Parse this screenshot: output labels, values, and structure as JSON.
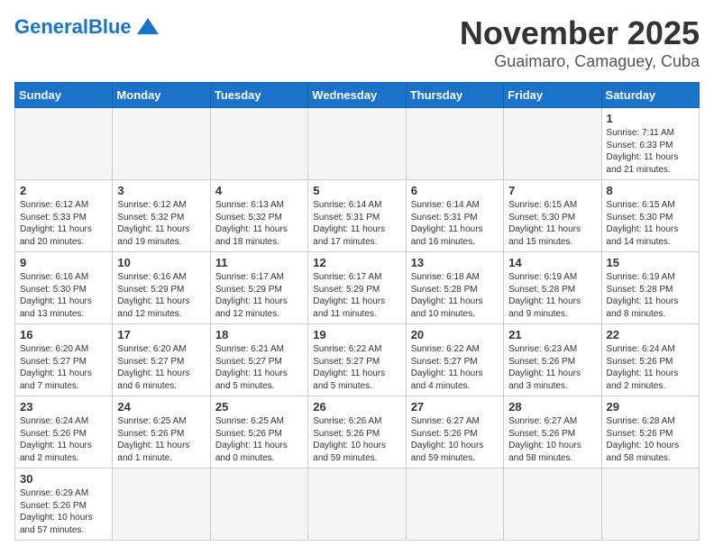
{
  "header": {
    "logo_general": "General",
    "logo_blue": "Blue",
    "month": "November 2025",
    "location": "Guaimaro, Camaguey, Cuba"
  },
  "days_of_week": [
    "Sunday",
    "Monday",
    "Tuesday",
    "Wednesday",
    "Thursday",
    "Friday",
    "Saturday"
  ],
  "weeks": [
    [
      {
        "day": null,
        "info": null
      },
      {
        "day": null,
        "info": null
      },
      {
        "day": null,
        "info": null
      },
      {
        "day": null,
        "info": null
      },
      {
        "day": null,
        "info": null
      },
      {
        "day": null,
        "info": null
      },
      {
        "day": "1",
        "info": "Sunrise: 7:11 AM\nSunset: 6:33 PM\nDaylight: 11 hours\nand 21 minutes."
      }
    ],
    [
      {
        "day": "2",
        "info": "Sunrise: 6:12 AM\nSunset: 5:33 PM\nDaylight: 11 hours\nand 20 minutes."
      },
      {
        "day": "3",
        "info": "Sunrise: 6:12 AM\nSunset: 5:32 PM\nDaylight: 11 hours\nand 19 minutes."
      },
      {
        "day": "4",
        "info": "Sunrise: 6:13 AM\nSunset: 5:32 PM\nDaylight: 11 hours\nand 18 minutes."
      },
      {
        "day": "5",
        "info": "Sunrise: 6:14 AM\nSunset: 5:31 PM\nDaylight: 11 hours\nand 17 minutes."
      },
      {
        "day": "6",
        "info": "Sunrise: 6:14 AM\nSunset: 5:31 PM\nDaylight: 11 hours\nand 16 minutes."
      },
      {
        "day": "7",
        "info": "Sunrise: 6:15 AM\nSunset: 5:30 PM\nDaylight: 11 hours\nand 15 minutes."
      },
      {
        "day": "8",
        "info": "Sunrise: 6:15 AM\nSunset: 5:30 PM\nDaylight: 11 hours\nand 14 minutes."
      }
    ],
    [
      {
        "day": "9",
        "info": "Sunrise: 6:16 AM\nSunset: 5:30 PM\nDaylight: 11 hours\nand 13 minutes."
      },
      {
        "day": "10",
        "info": "Sunrise: 6:16 AM\nSunset: 5:29 PM\nDaylight: 11 hours\nand 12 minutes."
      },
      {
        "day": "11",
        "info": "Sunrise: 6:17 AM\nSunset: 5:29 PM\nDaylight: 11 hours\nand 12 minutes."
      },
      {
        "day": "12",
        "info": "Sunrise: 6:17 AM\nSunset: 5:29 PM\nDaylight: 11 hours\nand 11 minutes."
      },
      {
        "day": "13",
        "info": "Sunrise: 6:18 AM\nSunset: 5:28 PM\nDaylight: 11 hours\nand 10 minutes."
      },
      {
        "day": "14",
        "info": "Sunrise: 6:19 AM\nSunset: 5:28 PM\nDaylight: 11 hours\nand 9 minutes."
      },
      {
        "day": "15",
        "info": "Sunrise: 6:19 AM\nSunset: 5:28 PM\nDaylight: 11 hours\nand 8 minutes."
      }
    ],
    [
      {
        "day": "16",
        "info": "Sunrise: 6:20 AM\nSunset: 5:27 PM\nDaylight: 11 hours\nand 7 minutes."
      },
      {
        "day": "17",
        "info": "Sunrise: 6:20 AM\nSunset: 5:27 PM\nDaylight: 11 hours\nand 6 minutes."
      },
      {
        "day": "18",
        "info": "Sunrise: 6:21 AM\nSunset: 5:27 PM\nDaylight: 11 hours\nand 5 minutes."
      },
      {
        "day": "19",
        "info": "Sunrise: 6:22 AM\nSunset: 5:27 PM\nDaylight: 11 hours\nand 5 minutes."
      },
      {
        "day": "20",
        "info": "Sunrise: 6:22 AM\nSunset: 5:27 PM\nDaylight: 11 hours\nand 4 minutes."
      },
      {
        "day": "21",
        "info": "Sunrise: 6:23 AM\nSunset: 5:26 PM\nDaylight: 11 hours\nand 3 minutes."
      },
      {
        "day": "22",
        "info": "Sunrise: 6:24 AM\nSunset: 5:26 PM\nDaylight: 11 hours\nand 2 minutes."
      }
    ],
    [
      {
        "day": "23",
        "info": "Sunrise: 6:24 AM\nSunset: 5:26 PM\nDaylight: 11 hours\nand 2 minutes."
      },
      {
        "day": "24",
        "info": "Sunrise: 6:25 AM\nSunset: 5:26 PM\nDaylight: 11 hours\nand 1 minute."
      },
      {
        "day": "25",
        "info": "Sunrise: 6:25 AM\nSunset: 5:26 PM\nDaylight: 11 hours\nand 0 minutes."
      },
      {
        "day": "26",
        "info": "Sunrise: 6:26 AM\nSunset: 5:26 PM\nDaylight: 10 hours\nand 59 minutes."
      },
      {
        "day": "27",
        "info": "Sunrise: 6:27 AM\nSunset: 5:26 PM\nDaylight: 10 hours\nand 59 minutes."
      },
      {
        "day": "28",
        "info": "Sunrise: 6:27 AM\nSunset: 5:26 PM\nDaylight: 10 hours\nand 58 minutes."
      },
      {
        "day": "29",
        "info": "Sunrise: 6:28 AM\nSunset: 5:26 PM\nDaylight: 10 hours\nand 58 minutes."
      }
    ],
    [
      {
        "day": "30",
        "info": "Sunrise: 6:29 AM\nSunset: 5:26 PM\nDaylight: 10 hours\nand 57 minutes."
      },
      {
        "day": null,
        "info": null
      },
      {
        "day": null,
        "info": null
      },
      {
        "day": null,
        "info": null
      },
      {
        "day": null,
        "info": null
      },
      {
        "day": null,
        "info": null
      },
      {
        "day": null,
        "info": null
      }
    ]
  ]
}
